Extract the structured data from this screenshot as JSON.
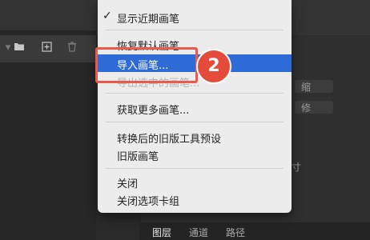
{
  "toolbar": {
    "icons": [
      "chevron-down-icon",
      "folder-icon",
      "add-icon",
      "trash-icon"
    ]
  },
  "right_panel": {
    "field_labels": [
      "缩",
      "修"
    ],
    "size_label": "尺寸",
    "tabs": [
      "图层",
      "通道",
      "路径"
    ]
  },
  "menu": {
    "items": [
      {
        "label": "显示近期画笔",
        "checked": true
      },
      {
        "label": "恢复默认画笔"
      },
      {
        "label": "导入画笔..."
      },
      {
        "label": "导出选中的画笔..."
      },
      {
        "label": "获取更多画笔..."
      },
      {
        "label": "转换后的旧版工具预设"
      },
      {
        "label": "旧版画笔"
      },
      {
        "label": "关闭"
      },
      {
        "label": "关闭选项卡组"
      }
    ],
    "check_mark": "✓"
  },
  "annotation": {
    "step_number": "2",
    "colors": {
      "highlight": "#2f6bd7",
      "annotation": "#e54b3b"
    }
  }
}
